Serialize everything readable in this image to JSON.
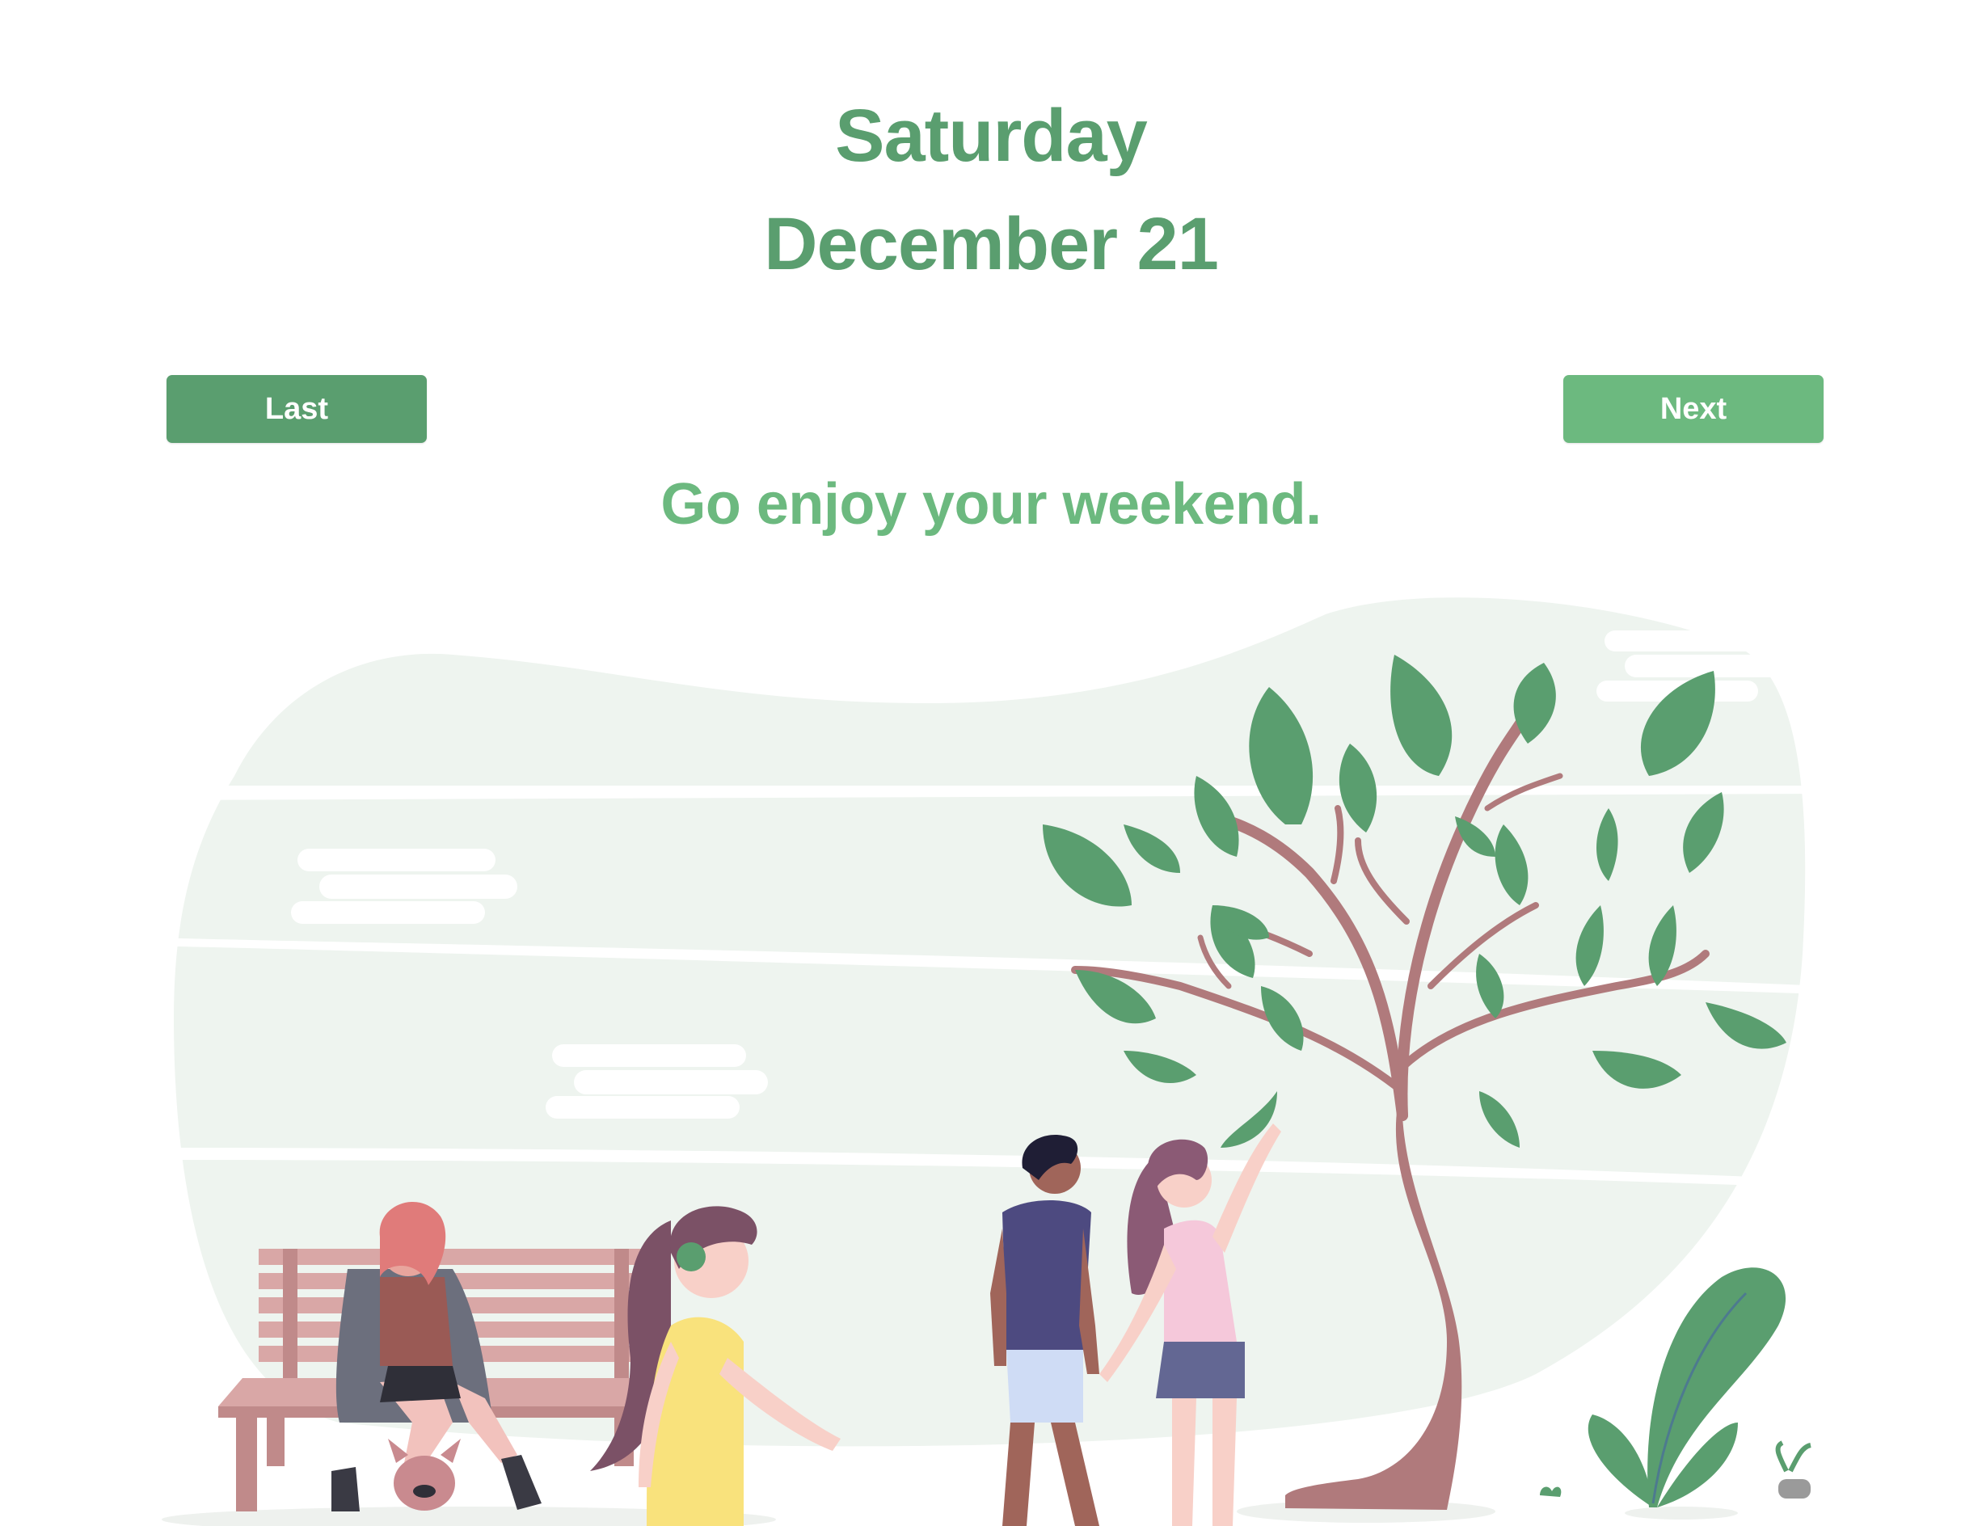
{
  "date": {
    "weekday": "Saturday",
    "month_day": "December 21"
  },
  "navigation": {
    "last_label": "Last",
    "next_label": "Next"
  },
  "message": "Go enjoy your weekend.",
  "colors": {
    "heading": "#5a9e6f",
    "last_button": "#5a9e6f",
    "next_button": "#6cb97f",
    "message": "#6cb97f",
    "leaf": "#5a9e6f",
    "trunk": "#b07a7c",
    "sky": "#eef4ef"
  },
  "illustration": {
    "icon": "park-scene-illustration"
  }
}
